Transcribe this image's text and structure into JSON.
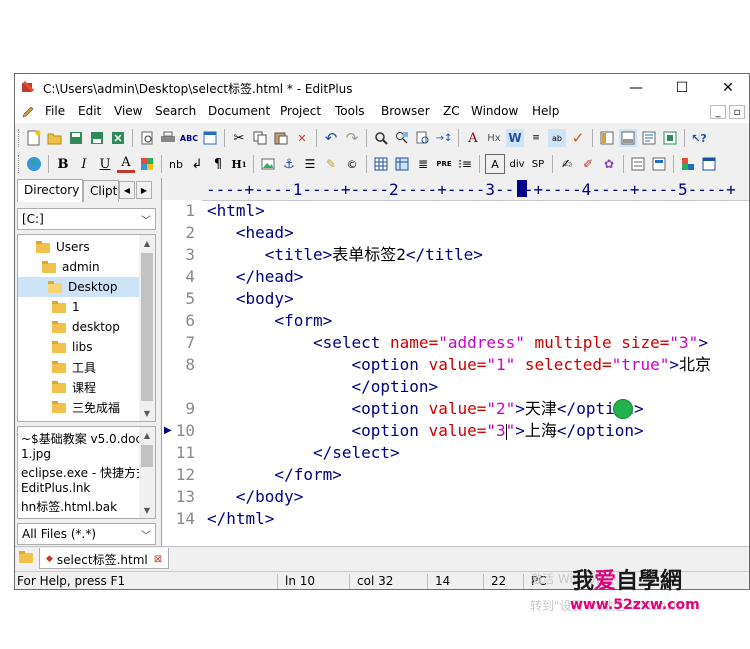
{
  "window": {
    "title": "C:\\Users\\admin\\Desktop\\select标签.html * - EditPlus",
    "minimize": "—",
    "maximize": "☐",
    "close": "✕"
  },
  "menu": [
    "File",
    "Edit",
    "View",
    "Search",
    "Document",
    "Project",
    "Tools",
    "Browser",
    "ZC",
    "Window",
    "Help"
  ],
  "sidebar": {
    "tabs": [
      "Directory",
      "Clipt"
    ],
    "drive": "[C:]",
    "tree": [
      "Users",
      "admin",
      "Desktop",
      "1",
      "desktop",
      "libs",
      "工具",
      "课程",
      "三免成福"
    ],
    "selected_folder": "Desktop",
    "files": [
      "~$基础教案 v5.0.doc",
      "1.jpg",
      "eclipse.exe - 快捷方式",
      "EditPlus.lnk",
      "hn标签.html.bak"
    ],
    "filter": "All Files (*.*)"
  },
  "ruler": "----+----1----+----2----+----3----+----4----+----5----+",
  "editor": {
    "line_numbers": [
      "1",
      "2",
      "3",
      "4",
      "5",
      "6",
      "7",
      "8",
      "",
      "9",
      "10",
      "11",
      "12",
      "13",
      "14"
    ],
    "lines": [
      [
        {
          "c": "t",
          "s": "<html>"
        }
      ],
      [
        {
          "c": "t",
          "s": "   <head>"
        }
      ],
      [
        {
          "c": "t",
          "s": "      <title>"
        },
        {
          "c": "x",
          "s": "表单标签2"
        },
        {
          "c": "t",
          "s": "</title>"
        }
      ],
      [
        {
          "c": "t",
          "s": "   </head>"
        }
      ],
      [
        {
          "c": "t",
          "s": "   <body>"
        }
      ],
      [
        {
          "c": "t",
          "s": "       <form>"
        }
      ],
      [
        {
          "c": "t",
          "s": "           <select "
        },
        {
          "c": "a",
          "s": "name="
        },
        {
          "c": "v",
          "s": "\"address\""
        },
        {
          "c": "a",
          "s": " multiple size="
        },
        {
          "c": "v",
          "s": "\"3\""
        },
        {
          "c": "t",
          "s": ">"
        }
      ],
      [
        {
          "c": "t",
          "s": "               <option "
        },
        {
          "c": "a",
          "s": "value="
        },
        {
          "c": "v",
          "s": "\"1\""
        },
        {
          "c": "a",
          "s": " selected="
        },
        {
          "c": "v",
          "s": "\"true\""
        },
        {
          "c": "t",
          "s": ">"
        },
        {
          "c": "x",
          "s": "北京"
        }
      ],
      [
        {
          "c": "t",
          "s": "               </option>"
        }
      ],
      [
        {
          "c": "t",
          "s": "               <option "
        },
        {
          "c": "a",
          "s": "value="
        },
        {
          "c": "v",
          "s": "\"2\""
        },
        {
          "c": "t",
          "s": ">"
        },
        {
          "c": "x",
          "s": "天津"
        },
        {
          "c": "t",
          "s": "</option>"
        }
      ],
      [
        {
          "c": "t",
          "s": "               <option "
        },
        {
          "c": "a",
          "s": "value="
        },
        {
          "c": "v",
          "s": "\"3"
        },
        {
          "c": "caret",
          "s": ""
        },
        {
          "c": "v",
          "s": "\""
        },
        {
          "c": "t",
          "s": ">"
        },
        {
          "c": "x",
          "s": "上海"
        },
        {
          "c": "t",
          "s": "</option>"
        }
      ],
      [
        {
          "c": "t",
          "s": "           </select>"
        }
      ],
      [
        {
          "c": "t",
          "s": "       </form>"
        }
      ],
      [
        {
          "c": "t",
          "s": "   </body>"
        }
      ],
      [
        {
          "c": "t",
          "s": "</html>"
        }
      ]
    ]
  },
  "doc_tab": "select标签.html",
  "status": {
    "help": "For Help, press F1",
    "line": "ln 10",
    "col": "col 32",
    "n1": "14",
    "n2": "22",
    "mode": "PC"
  },
  "watermark": {
    "brand_pre": "我",
    "brand_heart": "爱",
    "brand_post": "自學網",
    "url": "www.52zxw.com",
    "faint1": "激活 Windows",
    "faint2": "转到\"设置\"以激活 Windows"
  },
  "colors": {
    "tag": "#000080",
    "attr": "#cc0000",
    "value": "#cc00cc",
    "accent": "#00008b"
  }
}
